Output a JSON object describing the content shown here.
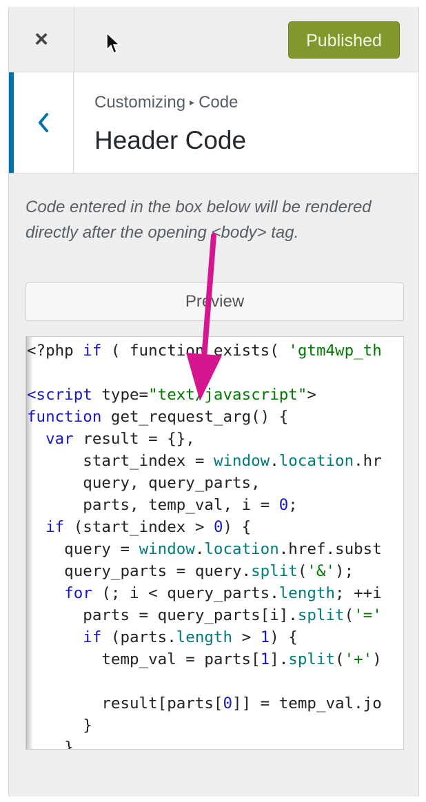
{
  "topbar": {
    "close_label": "×",
    "publish_label": "Published"
  },
  "section": {
    "breadcrumb_parent": "Customizing",
    "breadcrumb_sep": "▸",
    "breadcrumb_current": "Code",
    "title": "Header Code"
  },
  "description": "Code entered in the box below will be rendered directly after the opening <body> tag.",
  "preview_label": "Preview",
  "editor": {
    "lines": [
      "<?php if ( function_exists( 'gtm4wp_th",
      "",
      "<script type=\"text/javascript\">",
      "function get_request_arg() {",
      "  var result = {},",
      "      start_index = window.location.hr",
      "      query, query_parts,",
      "      parts, temp_val, i = 0;",
      "  if (start_index > 0) {",
      "    query = window.location.href.subst",
      "    query_parts = query.split('&');",
      "    for (; i < query_parts.length; ++i",
      "      parts = query_parts[i].split('='",
      "      if (parts.length > 1) {",
      "        temp_val = parts[1].split('+')",
      "",
      "        result[parts[0]] = temp_val.jo",
      "      }",
      "    }"
    ]
  },
  "colors": {
    "accent": "#0073aa",
    "publish_bg": "#82982f",
    "annotation_arrow": "#d6168f"
  }
}
